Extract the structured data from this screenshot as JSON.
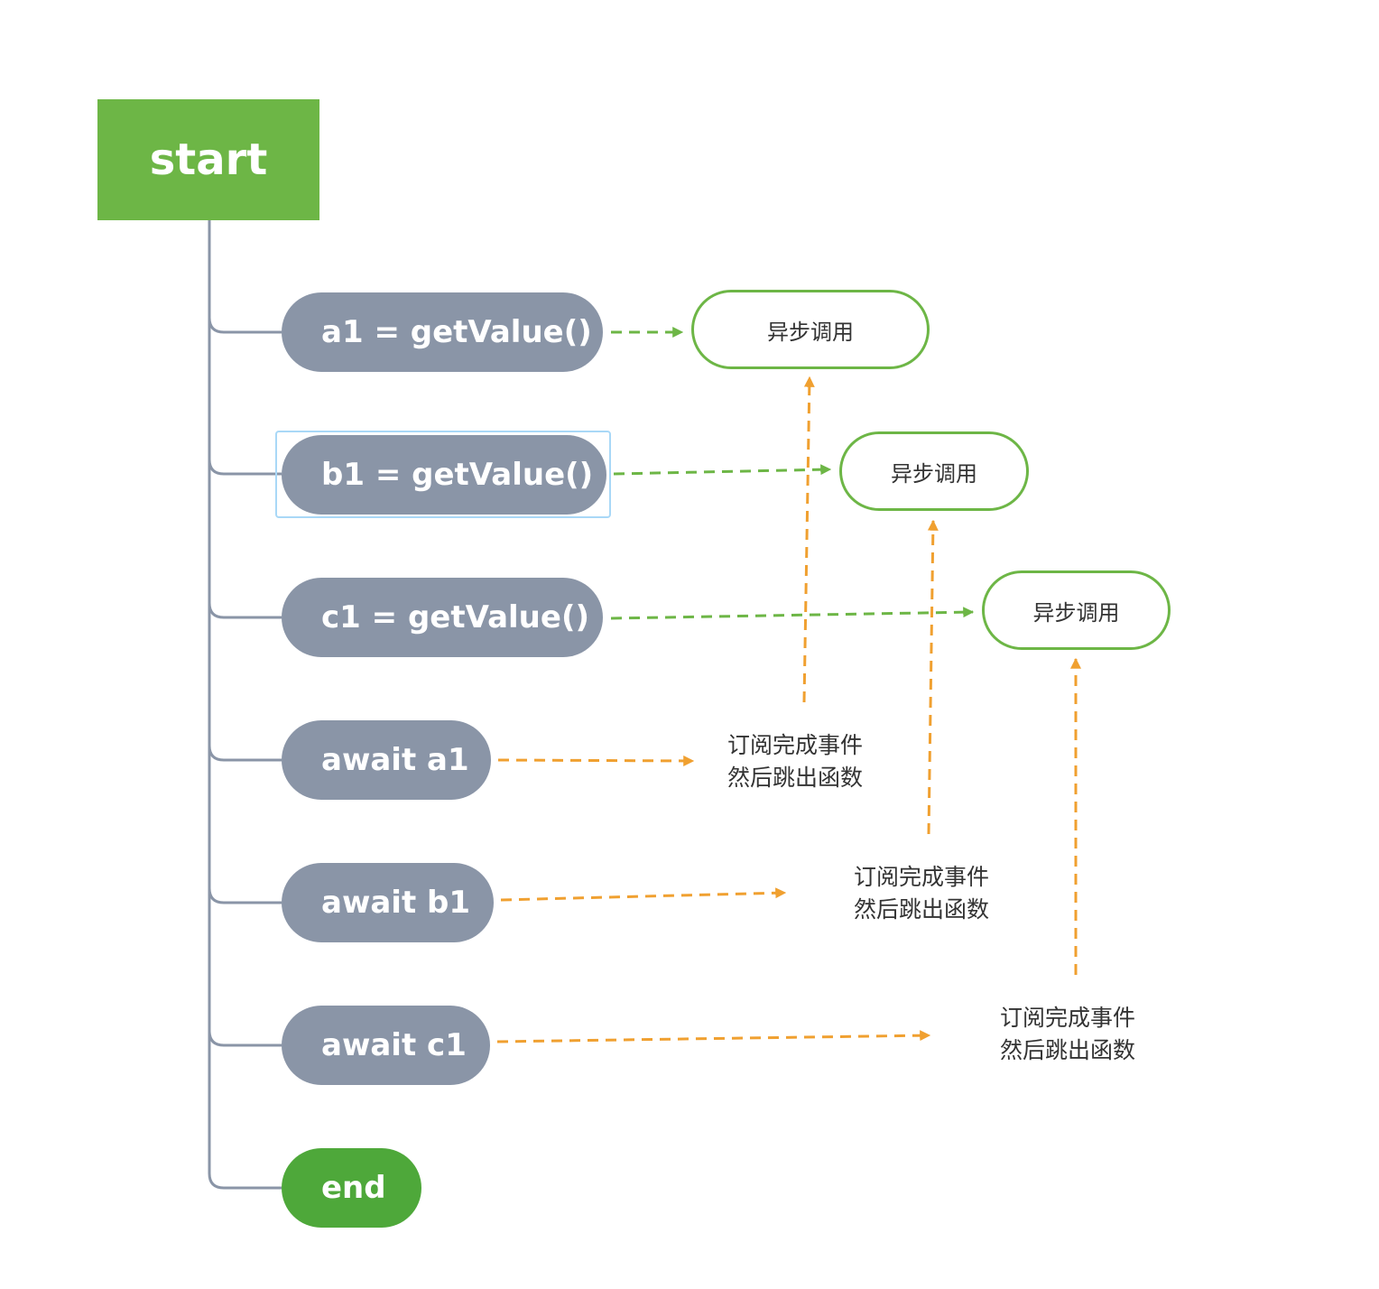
{
  "start": {
    "label": "start"
  },
  "steps": [
    {
      "id": "a1",
      "label": "a1 = getValue()"
    },
    {
      "id": "b1",
      "label": "b1 = getValue()"
    },
    {
      "id": "c1",
      "label": "c1 = getValue()"
    },
    {
      "id": "await_a1",
      "label": "await a1"
    },
    {
      "id": "await_b1",
      "label": "await b1"
    },
    {
      "id": "await_c1",
      "label": "await c1"
    }
  ],
  "end": {
    "label": "end"
  },
  "async_calls": [
    {
      "label": "异步调用"
    },
    {
      "label": "异步调用"
    },
    {
      "label": "异步调用"
    }
  ],
  "notes": [
    {
      "line1": "订阅完成事件",
      "line2": "然后跳出函数"
    },
    {
      "line1": "订阅完成事件",
      "line2": "然后跳出函数"
    },
    {
      "line1": "订阅完成事件",
      "line2": "然后跳出函数"
    }
  ],
  "colors": {
    "start_fill": "#6db646",
    "step_fill": "#8a95a7",
    "end_fill": "#4ea83a",
    "async_border": "#6db646",
    "green_arrow": "#6db646",
    "orange_arrow": "#f0a030",
    "trunk": "#8a95a7",
    "selection": "#a9d8f7"
  }
}
